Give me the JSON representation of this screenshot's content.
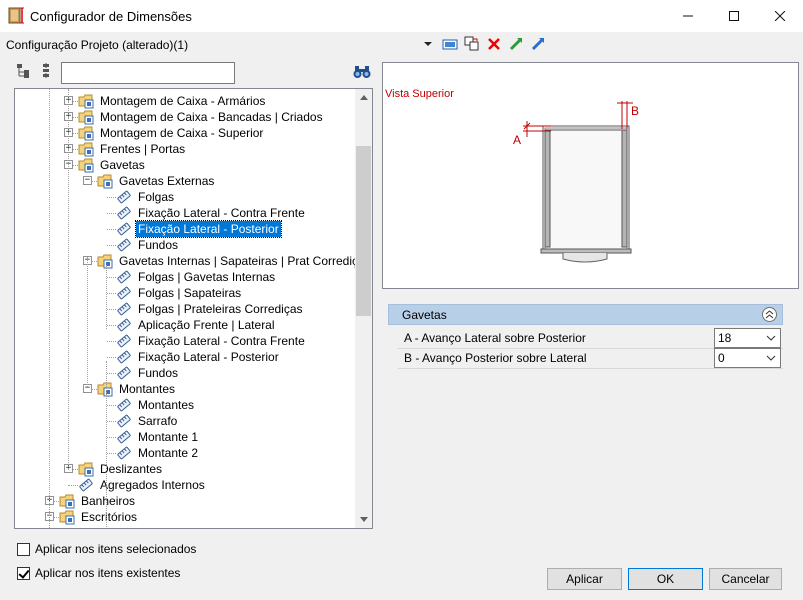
{
  "window": {
    "title": "Configurador de Dimensões",
    "minimize": "—",
    "maximize": "☐",
    "close": "✕"
  },
  "config": {
    "label": "Configuração Projeto (alterado)(1)"
  },
  "search": {
    "value": "",
    "placeholder": ""
  },
  "tree": {
    "items": [
      {
        "label": "Montagem de Caixa - Armários",
        "level": 2,
        "expander": "+",
        "icon": "folder-gear-icon"
      },
      {
        "label": "Montagem de Caixa - Bancadas | Criados",
        "level": 2,
        "expander": "+",
        "icon": "folder-gear-icon"
      },
      {
        "label": "Montagem de Caixa - Superior",
        "level": 2,
        "expander": "+",
        "icon": "folder-gear-icon"
      },
      {
        "label": "Frentes | Portas",
        "level": 2,
        "expander": "+",
        "icon": "folder-gear-icon"
      },
      {
        "label": "Gavetas",
        "level": 2,
        "expander": "−",
        "icon": "folder-gear-icon"
      },
      {
        "label": "Gavetas Externas",
        "level": 3,
        "expander": "−",
        "icon": "folder-gear-icon"
      },
      {
        "label": "Folgas",
        "level": 4,
        "expander": "",
        "icon": "tape-measure-icon"
      },
      {
        "label": "Fixação Lateral - Contra Frente",
        "level": 4,
        "expander": "",
        "icon": "tape-measure-icon"
      },
      {
        "label": "Fixação Lateral - Posterior",
        "level": 4,
        "expander": "",
        "icon": "tape-measure-icon",
        "selected": true
      },
      {
        "label": "Fundos",
        "level": 4,
        "expander": "",
        "icon": "tape-measure-icon"
      },
      {
        "label": "Gavetas Internas | Sapateiras | Prat Corrediça",
        "level": 3,
        "expander": "−",
        "icon": "folder-gear-icon"
      },
      {
        "label": "Folgas | Gavetas Internas",
        "level": 4,
        "expander": "",
        "icon": "tape-measure-icon"
      },
      {
        "label": "Folgas | Sapateiras",
        "level": 4,
        "expander": "",
        "icon": "tape-measure-icon"
      },
      {
        "label": "Folgas | Prateleiras Corrediças",
        "level": 4,
        "expander": "",
        "icon": "tape-measure-icon"
      },
      {
        "label": "Aplicação Frente | Lateral",
        "level": 4,
        "expander": "",
        "icon": "tape-measure-icon"
      },
      {
        "label": "Fixação Lateral - Contra Frente",
        "level": 4,
        "expander": "",
        "icon": "tape-measure-icon"
      },
      {
        "label": "Fixação Lateral - Posterior",
        "level": 4,
        "expander": "",
        "icon": "tape-measure-icon"
      },
      {
        "label": "Fundos",
        "level": 4,
        "expander": "",
        "icon": "tape-measure-icon"
      },
      {
        "label": "Montantes",
        "level": 3,
        "expander": "−",
        "icon": "folder-gear-icon"
      },
      {
        "label": "Montantes",
        "level": 4,
        "expander": "",
        "icon": "tape-measure-icon"
      },
      {
        "label": "Sarrafo",
        "level": 4,
        "expander": "",
        "icon": "tape-measure-icon"
      },
      {
        "label": "Montante 1",
        "level": 4,
        "expander": "",
        "icon": "tape-measure-icon"
      },
      {
        "label": "Montante 2",
        "level": 4,
        "expander": "",
        "icon": "tape-measure-icon"
      },
      {
        "label": "Deslizantes",
        "level": 2,
        "expander": "+",
        "icon": "folder-gear-icon"
      },
      {
        "label": "Agregados Internos",
        "level": 2,
        "expander": "",
        "icon": "tape-measure-icon"
      },
      {
        "label": "Banheiros",
        "level": 1,
        "expander": "+",
        "icon": "folder-gear-icon"
      },
      {
        "label": "Escritórios",
        "level": 1,
        "expander": "−",
        "icon": "folder-gear-icon"
      }
    ]
  },
  "preview": {
    "title": "Vista Superior",
    "label_a": "A",
    "label_b": "B"
  },
  "properties": {
    "group": "Gavetas",
    "rows": [
      {
        "label": "A - Avanço Lateral sobre Posterior",
        "value": "18"
      },
      {
        "label": "B - Avanço Posterior sobre Lateral",
        "value": "0"
      }
    ]
  },
  "options": {
    "apply_selected": "Aplicar nos itens selecionados",
    "apply_selected_checked": false,
    "apply_existing": "Aplicar nos itens existentes",
    "apply_existing_checked": true
  },
  "buttons": {
    "apply": "Aplicar",
    "ok": "OK",
    "cancel": "Cancelar"
  },
  "colors": {
    "selection": "#0078d7",
    "group_header": "#b8cfe8",
    "dimension_red": "#c00000"
  }
}
